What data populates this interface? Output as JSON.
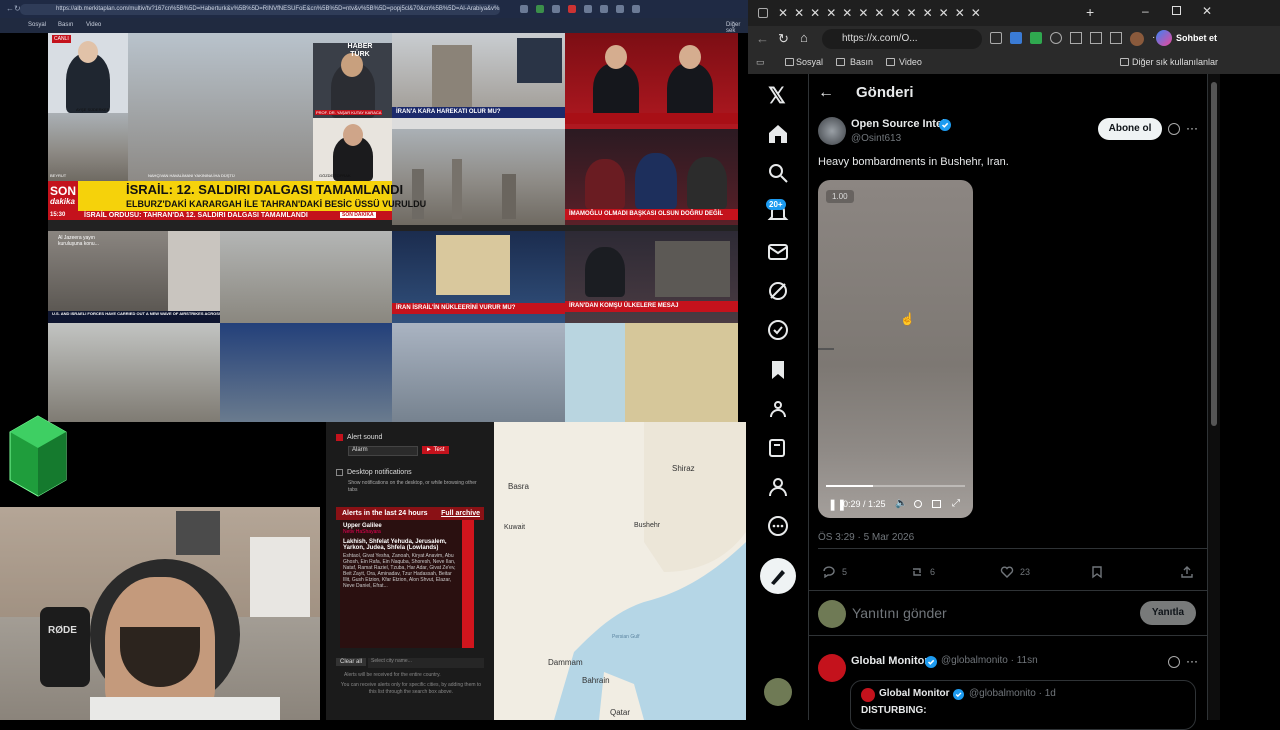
{
  "left_browser": {
    "url": "https://alb.merkitaplan.com/multiv/tv?167cn%5B%5D=Haberturk&v%5B%5D=RINVfNESUFoE&cn%5B%5D=ntv&v%5B%5D=popj5cl&70&cn%5B%5D=Al-Arabiya&v%5B%5D=...",
    "bookmarks": [
      "Sosyal",
      "Basın",
      "Video"
    ],
    "bookmarks_right": "Diğer sek",
    "news": {
      "canli": "CANLI",
      "haber_turk": "HABER TÜRK",
      "son": "SON",
      "dakika": "dakika",
      "headline1": "İSRAİL: 12. SALDIRI DALGASI TAMAMLANDI",
      "headline2": "ELBURZ'DAKİ KARARGAH İLE TAHRAN'DAKİ BESİC ÜSSÜ VURULDU",
      "ticker": "İSRAİL ORDUSU: TAHRAN'DA 12. SALDIRI DALGASI TAMAMLANDI",
      "son_dakika_tag": "SON DAKİKA",
      "iran_kara": "İRAN'A KARA HAREKATI OLUR MU?",
      "imamoglu": "İMAMOĞLU OLMADI BAŞKASI OLSUN DOĞRU DEĞİL",
      "iran_israil": "İRAN İSRAİL'İN NÜKLEERİNİ VURUR MU?",
      "iran_komsu": "İRAN'DAN KOMŞU ÜLKELERE MESAJ",
      "ayse": "AYŞE SÜDERKER",
      "beyrut": "BEYRUT",
      "nahcivan": "NAHÇIVAN HAVALİMANI YAKININA İHA DÜŞTÜ",
      "prof": "PROF. DR. YAŞAR KUTAY KARACA",
      "gozde": "GÖZDE TOPRAK",
      "us_israel": "U.S. AND ISRAELI FORCES HAVE CARRIED OUT A NEW WAVE OF AIRSTRIKES ACROSS IRAN",
      "al_jazeera": "Al Jazeera yayın kuruluşuna konu...",
      "time": "15:30"
    },
    "alert_panel": {
      "alert_sound": "Alert sound",
      "alarm_select": "Alarm",
      "test_btn": "► Test",
      "desktop_notifications": "Desktop notifications",
      "desktop_desc": "Show notifications on the desktop, or while browsing other tabs",
      "alerts_24h": "Alerts in the last 24 hours",
      "full_archive": "Full archive",
      "region1": "Upper Galilee",
      "region1_sub": "Netiv HaShayara",
      "region2": "Lakhish, Shfelat Yehuda, Jerusalem, Yarkon, Judea, Shfela (Lowlands)",
      "locations": "Eshtaol, Givat Yesha, Zanoah, Kiryat Anavim, Abu Ghosh, Ein Rafa, Ein Naquba, Shoresh, Neve Ilan, Nataf, Ramat Raziel, Tzuba, Har Adar, Givat Ze'ev, Beit Zayit, Ora, Aminadav, Tzur Hadassah, Beitar Illit, Gush Etzion, Kfar Etzion, Alon Shvut, Elazar, Neve Daniel, Efrat...",
      "clear_all": "Clear all",
      "city_placeholder": "Select city name...",
      "alerts_note": "Alerts will be received for the entire country.",
      "alerts_note2": "You can receive alerts only for specific cities, by adding them to this list through the search box above."
    },
    "map_labels": {
      "basra": "Basra",
      "shiraz": "Shiraz",
      "kuwait": "Kuwait",
      "bushehr": "Bushehr",
      "dammam": "Dammam",
      "bahrain": "Bahrain",
      "qatar": "Qatar",
      "gulf": "Persian Gulf"
    },
    "mic_label": "RØDE"
  },
  "right_browser": {
    "url": "https://x.com/O...",
    "bookmarks": [
      "Sosyal",
      "Basın",
      "Video"
    ],
    "other_bookmarks": "Diğer sık kullanılanlar",
    "copilot": "Sohbet et"
  },
  "x": {
    "header_title": "Gönderi",
    "notif_badge": "20+",
    "author_name": "Open Source Intel",
    "author_handle": "@Osint613",
    "follow_button": "Abone ol",
    "post_text": "Heavy bombardments in Bushehr, Iran.",
    "video_speed": "1.00",
    "video_time": "0:29 / 1:25",
    "video_progress": 0.34,
    "timestamp": "ÖS 3:29 · 5 Mar 2026",
    "replies": "5",
    "reposts": "6",
    "likes": "23",
    "reply_placeholder": "Yanıtını gönder",
    "reply_button": "Yanıtla",
    "next_author": "Global Monitor",
    "next_handle": "@globalmonito · 11sn",
    "quote_author": "Global Monitor",
    "quote_handle": "@globalmonito · 1d",
    "quote_text": "DISTURBING:"
  },
  "colors": {
    "x_bg": "#000000",
    "x_blue": "#1d9bf0",
    "news_red": "#c4121c",
    "news_yellow": "#f5d20b"
  }
}
